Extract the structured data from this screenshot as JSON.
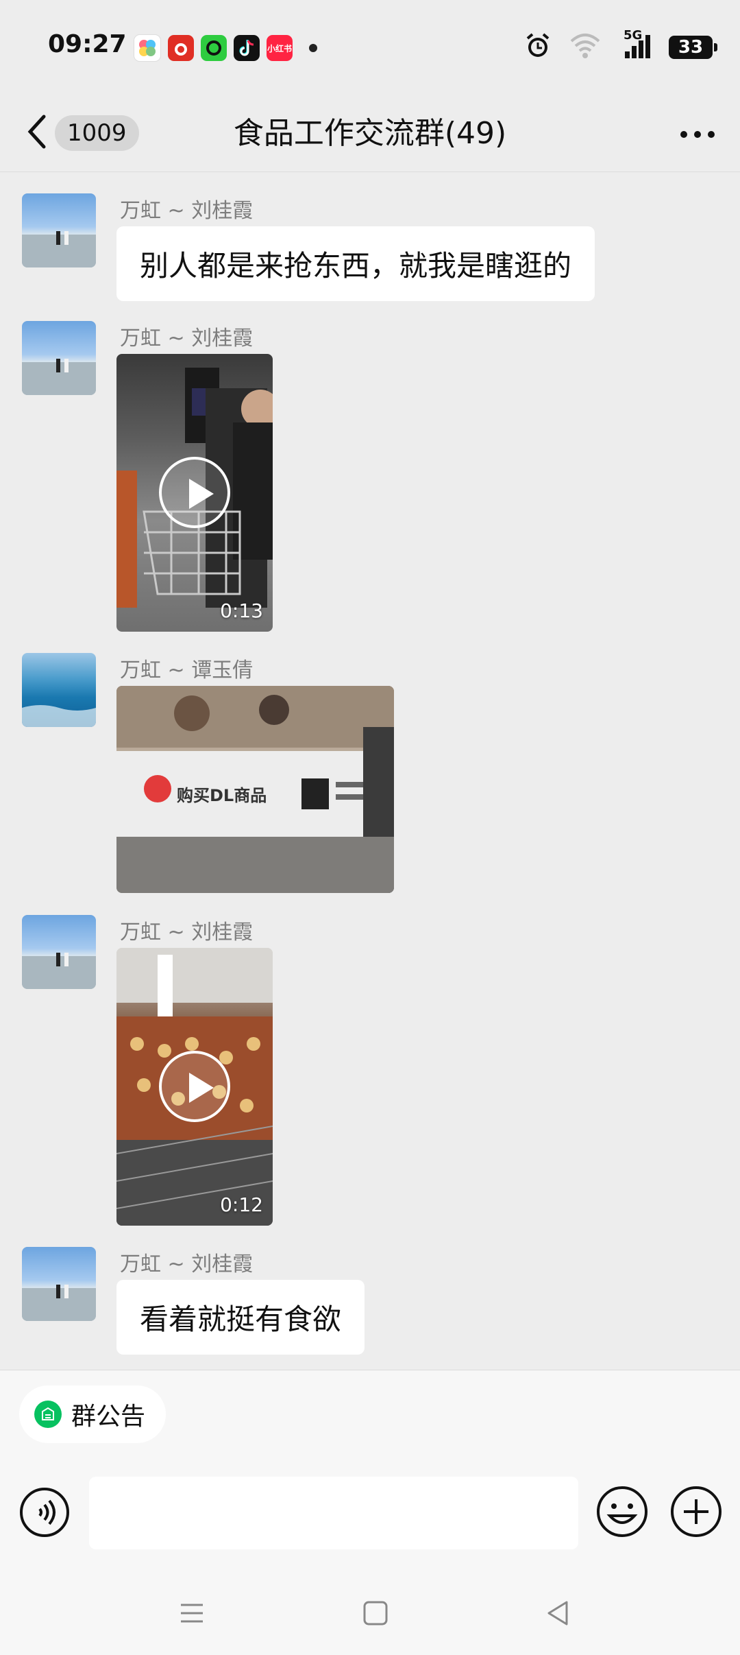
{
  "status_bar": {
    "time": "09:27",
    "notification_icons": [
      {
        "name": "photos-app-icon",
        "color": "#ffffff"
      },
      {
        "name": "pinduoduo-app-icon",
        "color": "#e02e24"
      },
      {
        "name": "green-circle-app-icon",
        "color": "#2ecc40"
      },
      {
        "name": "tiktok-app-icon",
        "color": "#111111"
      },
      {
        "name": "xiaohongshu-app-icon",
        "color": "#ff2442",
        "label": "小红书"
      }
    ],
    "network": "5G",
    "battery": "33"
  },
  "header": {
    "unread_count": "1009",
    "title": "食品工作交流群(49)"
  },
  "messages": [
    {
      "sender": "万虹 ~ 刘桂霞",
      "type": "text",
      "text": "别人都是来抢东西，就我是瞎逛的"
    },
    {
      "sender": "万虹 ~ 刘桂霞",
      "type": "video",
      "duration": "0:13"
    },
    {
      "sender": "万虹 ~ 谭玉倩",
      "type": "image",
      "sign_text": "购买DL商品"
    },
    {
      "sender": "万虹 ~ 刘桂霞",
      "type": "video",
      "duration": "0:12"
    },
    {
      "sender": "万虹 ~ 刘桂霞",
      "type": "text",
      "text": "看着就挺有食欲"
    }
  ],
  "bottom": {
    "announcement_label": "群公告",
    "input_placeholder": ""
  },
  "colors": {
    "background": "#ededed",
    "bubble": "#ffffff",
    "accent_green": "#07c160",
    "sender_gray": "#7d7d7d"
  }
}
